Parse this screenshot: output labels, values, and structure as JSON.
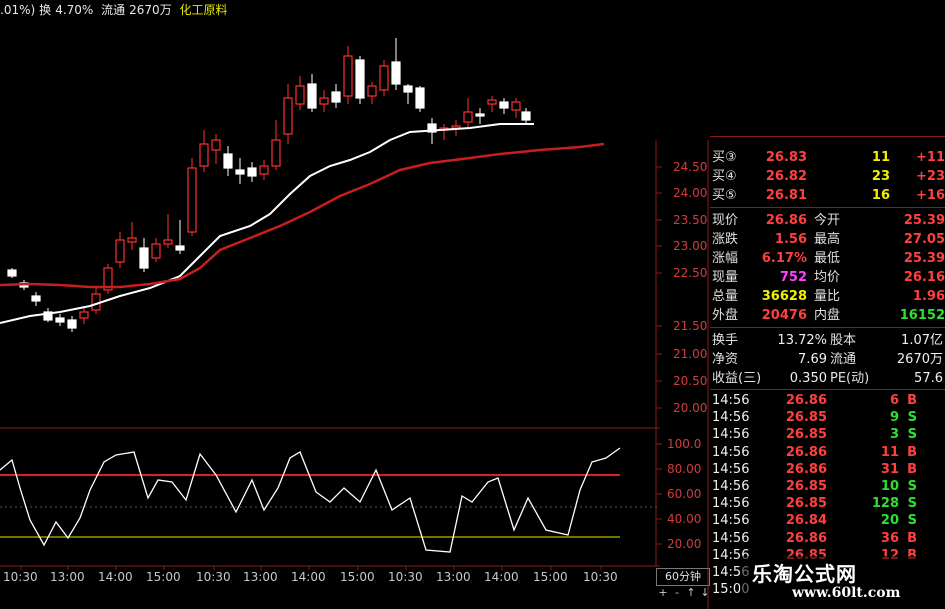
{
  "header": {
    "change": ".01%)",
    "turnover_label": "换",
    "turnover": "4.70%",
    "float_label": "流通",
    "float": "2670万",
    "sector": "化工原料"
  },
  "price_axis": [
    "24.50",
    "24.00",
    "23.50",
    "23.00",
    "22.50",
    "21.50",
    "21.00",
    "20.50",
    "20.00"
  ],
  "ind_axis": [
    "100.0",
    "80.00",
    "60.00",
    "40.00",
    "20.00"
  ],
  "time_axis": [
    "10:30",
    "13:00",
    "14:00",
    "15:00",
    "10:30",
    "13:00",
    "14:00",
    "15:00",
    "10:30",
    "13:00",
    "14:00",
    "15:00",
    "10:30"
  ],
  "period": "60分钟",
  "nav": [
    "+",
    "-",
    "↑",
    "↓"
  ],
  "quote": {
    "bids": [
      {
        "label": "买③",
        "price": "26.83",
        "vol": "11",
        "chg": "+11"
      },
      {
        "label": "买④",
        "price": "26.82",
        "vol": "23",
        "chg": "+23"
      },
      {
        "label": "买⑤",
        "price": "26.81",
        "vol": "16",
        "chg": "+16"
      }
    ],
    "stats": [
      {
        "l1": "现价",
        "v1": "26.86",
        "l2": "今开",
        "v2": "25.39"
      },
      {
        "l1": "涨跌",
        "v1": "1.56",
        "l2": "最高",
        "v2": "27.05"
      },
      {
        "l1": "涨幅",
        "v1": "6.17%",
        "l2": "最低",
        "v2": "25.39"
      },
      {
        "l1": "现量",
        "v1": "752",
        "l2": "均价",
        "v2": "26.16"
      },
      {
        "l1": "总量",
        "v1": "36628",
        "l2": "量比",
        "v2": "1.96"
      },
      {
        "l1": "外盘",
        "v1": "20476",
        "l2": "内盘",
        "v2": "16152"
      }
    ],
    "fund": [
      {
        "l1": "换手",
        "v1": "13.72%",
        "l2": "股本",
        "v2": "1.07亿"
      },
      {
        "l1": "净资",
        "v1": "7.69",
        "l2": "流通",
        "v2": "2670万"
      },
      {
        "l1": "收益(三)",
        "v1": "0.350",
        "l2": "PE(动)",
        "v2": "57.6"
      }
    ]
  },
  "trades": [
    {
      "t": "14:56",
      "p": "26.86",
      "v": "6",
      "s": "B"
    },
    {
      "t": "14:56",
      "p": "26.85",
      "v": "9",
      "s": "S"
    },
    {
      "t": "14:56",
      "p": "26.85",
      "v": "3",
      "s": "S"
    },
    {
      "t": "14:56",
      "p": "26.86",
      "v": "11",
      "s": "B"
    },
    {
      "t": "14:56",
      "p": "26.86",
      "v": "31",
      "s": "B"
    },
    {
      "t": "14:56",
      "p": "26.85",
      "v": "10",
      "s": "S"
    },
    {
      "t": "14:56",
      "p": "26.85",
      "v": "128",
      "s": "S"
    },
    {
      "t": "14:56",
      "p": "26.84",
      "v": "20",
      "s": "S"
    },
    {
      "t": "14:56",
      "p": "26.86",
      "v": "36",
      "s": "B"
    },
    {
      "t": "14:56",
      "p": "26.85",
      "v": "12",
      "s": "B"
    },
    {
      "t": "14:56",
      "p": "",
      "v": "",
      "s": ""
    },
    {
      "t": "15:00",
      "p": "",
      "v": "",
      "s": ""
    }
  ],
  "watermark": {
    "title": "乐淘公式网",
    "url": "www.60lt.com"
  },
  "colors": {
    "up": "#ff3030",
    "down": "#ffffff",
    "ma_short": "#ffffff",
    "ma_long": "#c81e1e",
    "grid": "#8a1c1c"
  }
}
